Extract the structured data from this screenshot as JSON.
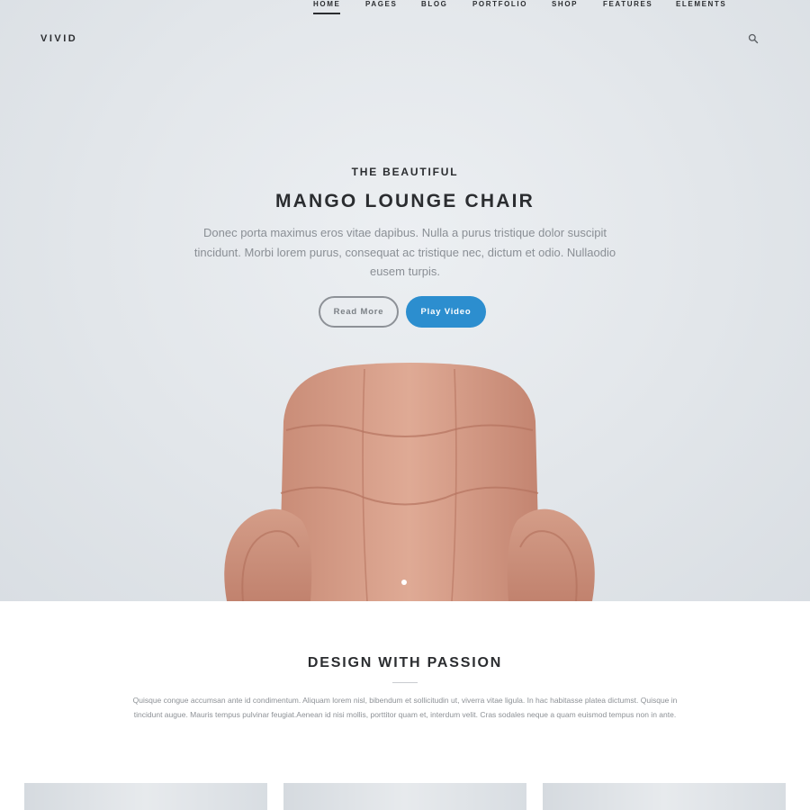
{
  "brand": {
    "logo": "VIVID"
  },
  "nav": {
    "items": [
      {
        "label": "HOME",
        "active": true
      },
      {
        "label": "PAGES"
      },
      {
        "label": "BLOG"
      },
      {
        "label": "PORTFOLIO"
      },
      {
        "label": "SHOP"
      },
      {
        "label": "FEATURES"
      },
      {
        "label": "ELEMENTS"
      }
    ],
    "search_icon": "search-icon"
  },
  "hero": {
    "subtitle": "THE BEAUTIFUL",
    "title": "MANGO LOUNGE CHAIR",
    "text": "Donec porta maximus eros vitae dapibus. Nulla a purus tristique dolor suscipit tincidunt. Morbi lorem purus, consequat ac tristique nec, dictum et odio. Nullaodio eusem turpis.",
    "read_more": "Read More",
    "play_video": "Play Video",
    "slides_total": 1,
    "slide_active": 1
  },
  "section": {
    "title": "DESIGN WITH PASSION",
    "text": "Quisque congue accumsan ante id condimentum. Aliquam lorem nisl, bibendum et sollicitudin ut, viverra vitae ligula. In hac habitasse platea dictumst. Quisque in tincidunt augue. Mauris tempus pulvinar feugiat.Aenean id nisi mollis, porttitor quam et, interdum velit. Cras sodales neque a quam euismod tempus non in ante."
  },
  "colors": {
    "accent": "#2c8ecf",
    "text_dark": "#2b2d30",
    "text_muted": "#8a8f95",
    "hero_bg": "#e2e6ea",
    "chair": "#d9a38e"
  }
}
